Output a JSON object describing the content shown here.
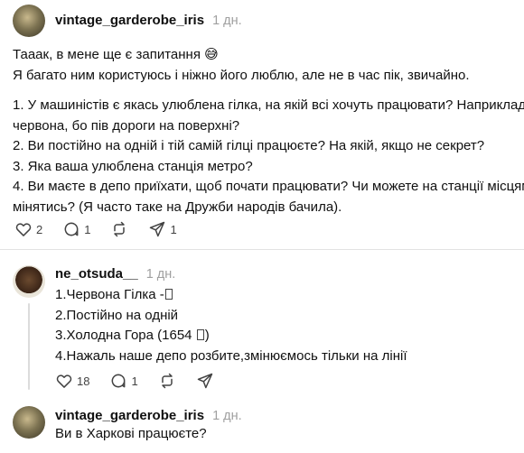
{
  "posts": [
    {
      "username": "vintage_garderobe_iris",
      "time": "1 дн.",
      "lines": [
        "Тааак, в мене ще є запитання 😅",
        "Я багато ним користуюсь і ніжно його люблю, але не в час пік, звичайно.",
        "",
        "1. У машиністів є якась улюблена гілка, на якій всі хочуть працювати? Наприклад,",
        "червона, бо пів дороги на поверхні?",
        "2. Ви постійно на одній і тій самій гілці працюєте? На якій, якщо не секрет?",
        "3. Яка ваша улюблена станція метро?",
        "4. Ви маєте в депо приїхати, щоб почати працювати? Чи можете на станції місцями",
        "мінятись? (Я часто таке на Дружби народів бачила)."
      ],
      "likes": "2",
      "comments": "1",
      "reposts": "",
      "shares": "1"
    },
    {
      "username": "ne_otsuda__",
      "time": "1 дн.",
      "lines": [
        "1.Червона Гілка -",
        "2.Постійно на одній",
        "3.Холодна Гора (1654 ",
        "4.Нажаль наше депо розбите,змінюємось тільки на лінії"
      ],
      "line_suffix": ")",
      "likes": "18",
      "comments": "1",
      "reposts": "",
      "shares": ""
    },
    {
      "username": "vintage_garderobe_iris",
      "time": "1 дн.",
      "lines": [
        "Ви в Харкові працюєте?"
      ]
    }
  ],
  "icons": [
    "heart-icon",
    "comment-icon",
    "repost-icon",
    "share-icon"
  ],
  "colors": {
    "text": "#101010",
    "muted": "#a0a0a0",
    "divider": "#e2e2e2"
  }
}
